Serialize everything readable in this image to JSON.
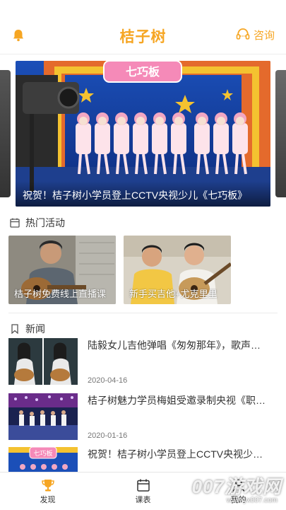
{
  "header": {
    "title": "桔子树",
    "consult_label": "咨询",
    "bell_icon": "bell-icon",
    "consult_icon": "headset-icon"
  },
  "banner": {
    "caption": "祝贺！桔子树小学员登上CCTV央视少儿《七巧板》",
    "stage_sign": "七巧板"
  },
  "hot_activities": {
    "title": "热门活动",
    "icon": "calendar-icon",
    "items": [
      {
        "caption": "桔子树免费线上直播课"
      },
      {
        "caption": "新手买吉他+尤克里里"
      }
    ]
  },
  "news": {
    "title": "新闻",
    "icon": "bookmark-icon",
    "items": [
      {
        "title": "陆毅女儿吉他弹唱《匆匆那年》，歌声…",
        "date": "2020-04-16"
      },
      {
        "title": "桔子树魅力学员梅姐受邀录制央视《职…",
        "date": "2020-01-16"
      },
      {
        "title": "祝贺！桔子树小学员登上CCTV央视少…",
        "date": ""
      }
    ]
  },
  "bottom_nav": {
    "items": [
      {
        "label": "发现",
        "icon": "trophy-icon"
      },
      {
        "label": "课表",
        "icon": "calendar-icon"
      },
      {
        "label": "我的",
        "icon": "user-icon"
      }
    ]
  },
  "watermark": {
    "text": "007游戏网",
    "url": "www.yx007.com"
  },
  "colors": {
    "accent": "#f6a623",
    "text": "#333333",
    "date": "#777777"
  }
}
